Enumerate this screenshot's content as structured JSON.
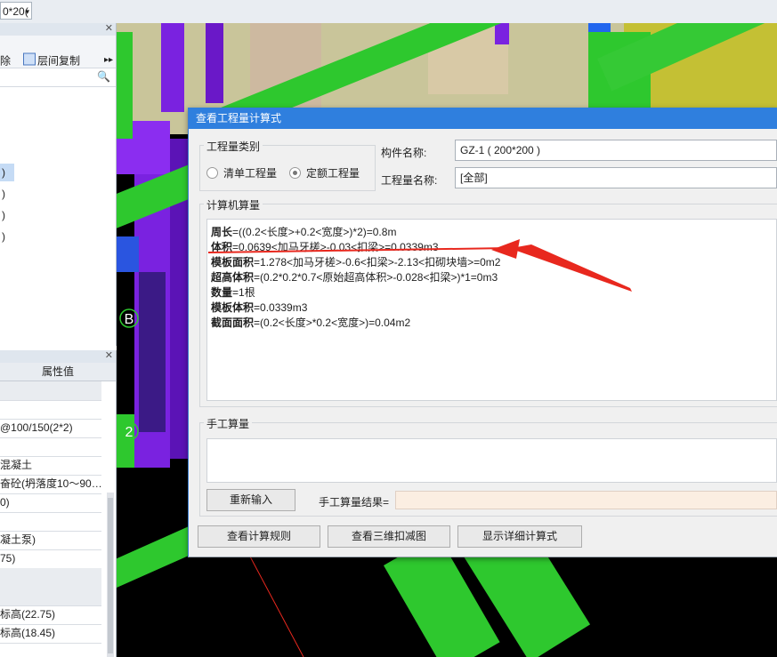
{
  "topbar": {
    "combo_value": "0*20("
  },
  "left_panel": {
    "toolbar": {
      "delete_label": "除",
      "copy_label": "层间复制",
      "more": "▸▸"
    },
    "tree_items": [
      ")",
      ")",
      ")",
      ")"
    ],
    "properties": {
      "column_header": "属性值",
      "rows": [
        "",
        "",
        "@100/150(2*2)",
        "",
        "混凝土",
        "奋砼(坍落度10～90…",
        "0)",
        "",
        "凝土泵)",
        "75)",
        "",
        "",
        "标高(22.75)",
        "标高(18.45)"
      ]
    }
  },
  "scene": {
    "axis_labels": [
      "B",
      "2"
    ]
  },
  "dialog": {
    "title": "查看工程量计算式",
    "category_group": {
      "title": "工程量类别",
      "options": [
        "清单工程量",
        "定额工程量"
      ],
      "selected": "定额工程量"
    },
    "component_name_label": "构件名称:",
    "component_name_value": "GZ-1 ( 200*200 )",
    "quantity_name_label": "工程量名称:",
    "quantity_name_value": "[全部]",
    "computer_calc": {
      "title": "计算机算量",
      "lines": [
        {
          "name": "周长",
          "expr": "=((0.2<长度>+0.2<宽度>)*2)=0.8m"
        },
        {
          "name": "体积",
          "expr": "=0.0639<加马牙槎>-0.03<扣梁>=0.0339m3"
        },
        {
          "name": "模板面积",
          "expr": "=1.278<加马牙槎>-0.6<扣梁>-2.13<扣砌块墙>=0m2"
        },
        {
          "name": "超高体积",
          "expr": "=(0.2*0.2*0.7<原始超高体积>-0.028<扣梁>)*1=0m3"
        },
        {
          "name": "数量",
          "expr": "=1根"
        },
        {
          "name": "模板体积",
          "expr": "=0.0339m3"
        },
        {
          "name": "截面面积",
          "expr": "=(0.2<长度>*0.2<宽度>)=0.04m2"
        }
      ]
    },
    "manual_calc": {
      "title": "手工算量",
      "reenter_button": "重新输入",
      "result_label": "手工算量结果="
    },
    "buttons": {
      "view_rules": "查看计算规则",
      "view_3d": "查看三维扣减图",
      "show_detail": "显示详细计算式"
    }
  },
  "colors": {
    "title_bar": "#2f7fde",
    "annotation_red": "#e8281e",
    "beam_green": "#2ec82e",
    "column_purple": "#7a22e0"
  }
}
